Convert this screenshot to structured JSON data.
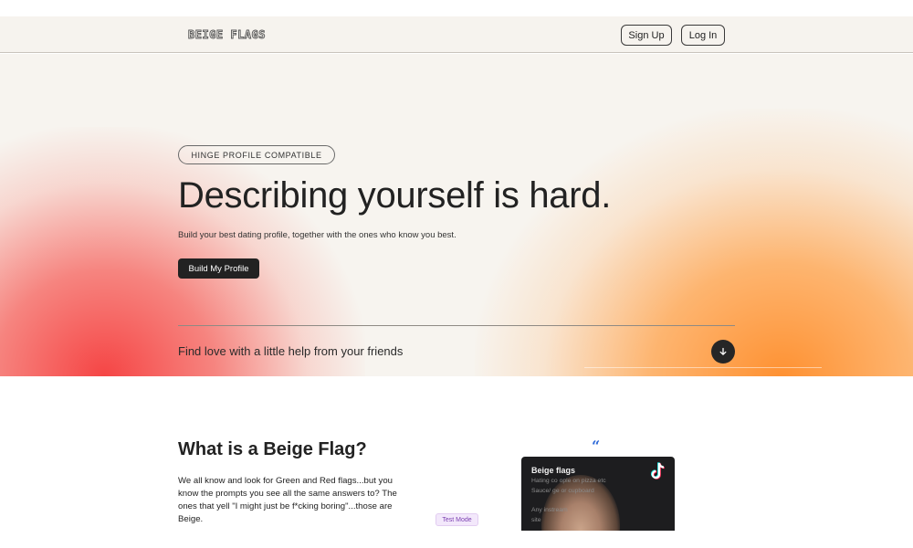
{
  "nav": {
    "logo": "BEIGE FLAGS",
    "signup_label": "Sign Up",
    "login_label": "Log In"
  },
  "hero": {
    "badge": "HINGE PROFILE COMPATIBLE",
    "title": "Describing yourself is hard.",
    "subtitle": "Build your best dating profile, together with the ones who know you best.",
    "cta_label": "Build My Profile",
    "tagline": "Find love with a little help from your friends",
    "scroll_icon": "arrow-down-icon"
  },
  "about": {
    "title": "What is a Beige Flag?",
    "body": "We all know and look for Green and Red flags...but you know the prompts you see all the same answers to? The ones that yell \"I might just be f*cking boring\"...those are Beige.",
    "test_badge": "Test Mode",
    "quote_icon": "quote-icon"
  },
  "video": {
    "heading": "Beige flags",
    "line1": "Hating co                        ople on pizza etc",
    "line2": "Sauce/                           ge or cupboard",
    "line3": "Any                                  instream",
    "line4": "site",
    "platform_icon": "tiktok-icon"
  },
  "colors": {
    "background": "#f7f4ef",
    "accent_red": "#f53c3c",
    "accent_orange": "#ff8c28",
    "dark": "#222222",
    "badge_purple": "#7a3fb0",
    "quote_blue": "#2f6bd8"
  }
}
